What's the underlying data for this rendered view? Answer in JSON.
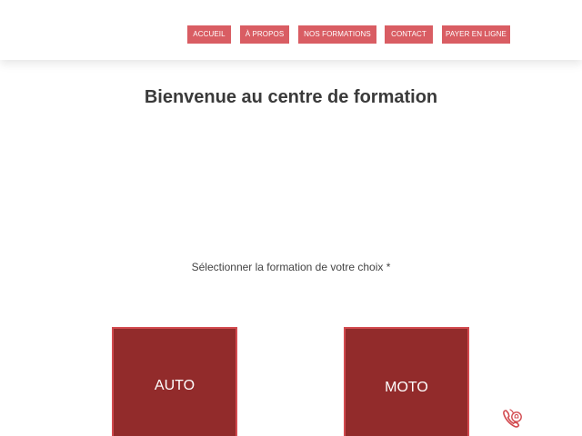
{
  "nav": {
    "items": [
      {
        "label": "ACCUEIL"
      },
      {
        "label": "À PROPOS"
      },
      {
        "label": "NOS FORMATIONS"
      },
      {
        "label": "CONTACT"
      },
      {
        "label": "PAYER EN LIGNE"
      }
    ]
  },
  "main": {
    "title": "Bienvenue au centre de formation",
    "subtitle": "Sélectionner la formation de votre choix *",
    "cards": [
      {
        "label": "AUTO"
      },
      {
        "label": "MOTO"
      }
    ]
  },
  "floating": {
    "icon": "phone-call-icon"
  },
  "colors": {
    "nav_button": "#d95d63",
    "card_fill": "#922b2b",
    "card_border": "#d24a4f",
    "title_text": "#3a3a3a"
  }
}
